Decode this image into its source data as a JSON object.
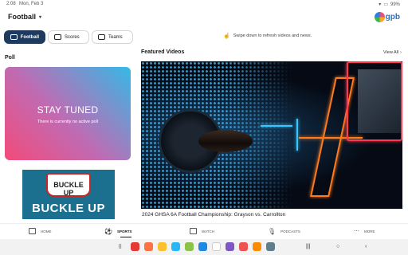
{
  "status": {
    "time": "2:08",
    "date": "Mon, Feb 3",
    "battery": "99%"
  },
  "header": {
    "title": "Football",
    "logo_text": "gpb"
  },
  "tabs": [
    {
      "label": "Football",
      "active": true
    },
    {
      "label": "Scores",
      "active": false
    },
    {
      "label": "Teams",
      "active": false
    }
  ],
  "hint": "Swipe down to refresh videos and news.",
  "poll": {
    "section_title": "Poll",
    "heading": "STAY TUNED",
    "message": "There is currently no active poll"
  },
  "ad": {
    "badge_text": "BUCKLE UP",
    "main_text": "BUCKLE UP"
  },
  "featured": {
    "section_title": "Featured Videos",
    "view_all": "View All",
    "video_caption": "2024 GHSA 6A Football Championship: Grayson vs. Carrollton"
  },
  "bottom_nav": [
    {
      "label": "HOME",
      "icon": "home-icon"
    },
    {
      "label": "SPORTS",
      "icon": "sports-icon",
      "active": true
    },
    {
      "label": "WATCH",
      "icon": "watch-icon"
    },
    {
      "label": "PODCASTS",
      "icon": "podcast-icon"
    },
    {
      "label": "MORE",
      "icon": "more-icon"
    }
  ],
  "colors": {
    "active_tab": "#1f3a5f",
    "poll_gradient_start": "#f24b7a",
    "poll_gradient_end": "#35b9e6",
    "logo_blue": "#2b6fc7"
  }
}
